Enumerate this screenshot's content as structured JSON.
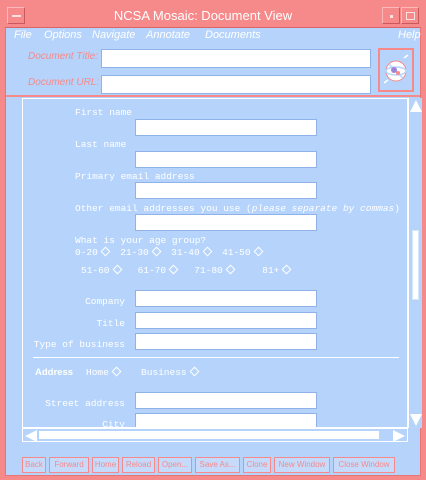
{
  "window": {
    "title": "NCSA Mosaic: Document View"
  },
  "menu": {
    "file": "File",
    "options": "Options",
    "navigate": "Navigate",
    "annotate": "Annotate",
    "documents": "Documents",
    "help": "Help"
  },
  "url_rows": {
    "title_label": "Document Title:",
    "url_label": "Document URL:"
  },
  "form": {
    "first_name": "First name",
    "last_name": "Last name",
    "primary_email": "Primary email address",
    "other_email": "Other email addresses you use (",
    "other_email_hint": "please separate by commas",
    "other_email_end": ")",
    "age_question": "What is your age group?",
    "age_options_row1": [
      "0-20",
      "21-30",
      "31-40",
      "41-50"
    ],
    "age_options_row2": [
      "51-60",
      "61-70",
      "71-80",
      "81+"
    ],
    "company": "Company",
    "title": "Title",
    "type_of_business": "Type of business",
    "address_label": "Address",
    "address_home": "Home",
    "address_business": "Business",
    "street_address": "Street address",
    "city": "City"
  },
  "bottom": {
    "status_text": "",
    "buttons": [
      "Back",
      "Forward",
      "Home",
      "Reload",
      "Open...",
      "Save As...",
      "Clone",
      "New Window",
      "Close Window"
    ]
  },
  "colors": {
    "frame": "#f6898a",
    "background": "#b6d4fb",
    "text": "#ffffff"
  }
}
